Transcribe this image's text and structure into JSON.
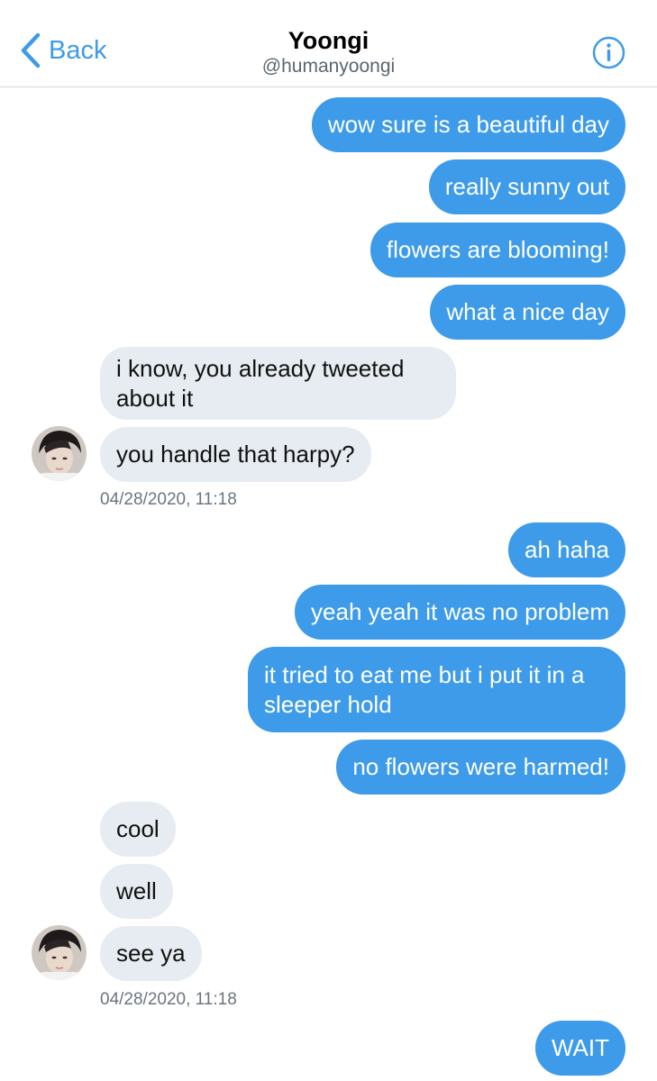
{
  "header": {
    "back_label": "Back",
    "title": "Yoongi",
    "handle": "@humanyoongi"
  },
  "messages": [
    {
      "text": "wow sure is a beautiful day"
    },
    {
      "text": "really sunny out"
    },
    {
      "text": "flowers are blooming!"
    },
    {
      "text": "what a nice day"
    },
    {
      "text": "i know, you already tweeted about it"
    },
    {
      "text": "you handle that harpy?"
    },
    {
      "text": "ah haha"
    },
    {
      "text": "yeah yeah it was no problem"
    },
    {
      "text": "it tried to eat me but i put it in a sleeper hold"
    },
    {
      "text": "no flowers were harmed!"
    },
    {
      "text": "cool"
    },
    {
      "text": "well"
    },
    {
      "text": "see ya"
    },
    {
      "text": "WAIT"
    }
  ],
  "timestamps": [
    "04/28/2020, 11:18",
    "04/28/2020, 11:18"
  ],
  "colors": {
    "outgoing": "#3d9be9",
    "incoming": "#e6ecf1",
    "accent": "#3d9be9"
  },
  "icons": {
    "back": "chevron-left-icon",
    "info": "info-icon"
  }
}
